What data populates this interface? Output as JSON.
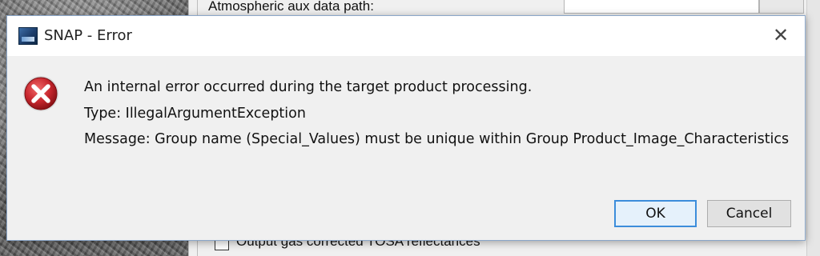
{
  "background_window": {
    "field_label": "Atmospheric aux data path:",
    "checkbox_label": "Output gas corrected TOSA reflectances"
  },
  "dialog": {
    "title": "SNAP - Error",
    "icons": {
      "app": "snap-app-icon",
      "error": "error-icon",
      "close": "close-icon"
    },
    "close_glyph": "✕",
    "message_lines": [
      "An internal error occurred during the target product processing.",
      "Type: IllegalArgumentException",
      "Message: Group name (Special_Values) must be unique within Group Product_Image_Characteristics"
    ],
    "buttons": {
      "ok": "OK",
      "cancel": "Cancel"
    }
  },
  "colors": {
    "error_red": "#c8272e",
    "ok_border": "#3c8ddb"
  }
}
